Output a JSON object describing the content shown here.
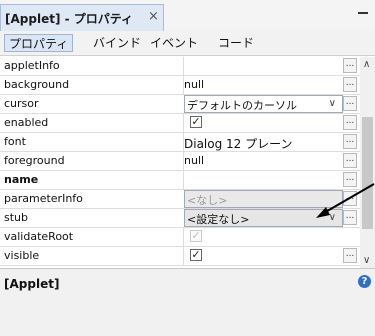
{
  "window": {
    "tab_title": "[Applet] - プロパティ",
    "close_symbol": "×"
  },
  "subtabs": [
    "プロパティ",
    "バインド",
    "イベント",
    "コード"
  ],
  "properties": [
    {
      "name": "appletInfo",
      "value": "",
      "control": "text"
    },
    {
      "name": "background",
      "value": "null",
      "control": "text"
    },
    {
      "name": "cursor",
      "value": "デフォルトのカーソル",
      "control": "combo"
    },
    {
      "name": "enabled",
      "value": "☑",
      "control": "check"
    },
    {
      "name": "font",
      "value": "Dialog 12 プレーン",
      "control": "text"
    },
    {
      "name": "foreground",
      "value": "null",
      "control": "text"
    },
    {
      "name": "name",
      "value": "",
      "control": "text"
    },
    {
      "name": "parameterInfo",
      "value": "<なし>",
      "control": "disabled"
    },
    {
      "name": "stub",
      "value": "<設定なし>",
      "control": "combo"
    },
    {
      "name": "validateRoot",
      "value": "☑",
      "control": "check_dim"
    },
    {
      "name": "visible",
      "value": "☑",
      "control": "check"
    }
  ],
  "dots_label": "...",
  "info": {
    "title": "[Applet]",
    "help_symbol": "?"
  }
}
